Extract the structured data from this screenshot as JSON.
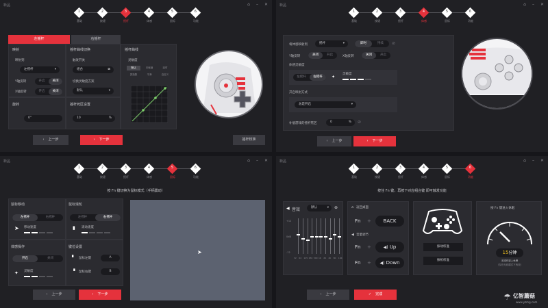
{
  "window": {
    "title": "新品",
    "ctrl_icons": [
      "pin-icon",
      "minimize-icon",
      "close-icon"
    ]
  },
  "steps": [
    {
      "num": "1",
      "label": "基础"
    },
    {
      "num": "2",
      "label": "按键"
    },
    {
      "num": "3",
      "label": "摇杆"
    },
    {
      "num": "4",
      "label": "体感"
    },
    {
      "num": "5",
      "label": "鼠标"
    },
    {
      "num": "6",
      "label": "功能"
    }
  ],
  "q1": {
    "tabs": {
      "left": "左摇杆",
      "right": "右摇杆"
    },
    "mapping": {
      "title": "映射",
      "mapto_label": "映射到",
      "mapto_value": "左摇杆",
      "y_invert": "Y轴反转",
      "x_invert": "X轴反转",
      "on": "开启",
      "off": "关闭"
    },
    "curve_switch": {
      "title": "摇杆曲线切换",
      "trigger_label": "触发开关",
      "trigger_value": "组合",
      "scheme_label": "切换灵敏度方案",
      "scheme_value": "默认"
    },
    "curve": {
      "title": "摇杆曲线",
      "sens_label": "灵敏度",
      "modes": [
        "默认",
        "已就绪",
        "延时",
        "类指数",
        "平滑",
        "自定义"
      ]
    },
    "rotate": {
      "title": "旋转",
      "value": "0°"
    },
    "deadzone": {
      "title": "摇杆死区设置",
      "value": "10",
      "unit": "%"
    },
    "prev": "上一步",
    "next": "下一步",
    "extra": "摇杆校准"
  },
  "q2": {
    "mapping_label": "将体感映射到",
    "mapping_value": "摇杆",
    "mode_a": "即时",
    "mode_b": "持续",
    "y_invert": "Y轴反转",
    "x_invert": "X轴反转",
    "on": "关闭",
    "off": "开启",
    "sens_title": "体感灵敏度",
    "stick_a": "左摇杆",
    "stick_b": "右摇杆",
    "sens_label": "灵敏度",
    "trigger_title": "开启映射方式",
    "trigger_value": "总是开启",
    "deadzone_label": "补偿游戏的摇杆死区",
    "deadzone_value": "0",
    "unit": "%",
    "prev": "上一步",
    "next": "下一步"
  },
  "q3": {
    "hint": "按 Fn 键切换为鼠标模式（手柄震动）",
    "move_title": "鼠标移动",
    "scroll_title": "鼠标滚轮",
    "move_left": "左摇杆",
    "move_right": "右摇杆",
    "move_speed": "移动速度",
    "scroll_left": "左摇杆",
    "scroll_right": "右摇杆",
    "scroll_speed": "滚动速度",
    "gyro_title": "体感操作",
    "gyro_on": "开启",
    "gyro_off": "关闭",
    "gyro_sens": "灵敏度",
    "keys_title": "键位设置",
    "left_click": "鼠标左键",
    "right_click": "鼠标右键",
    "key_a": "A",
    "key_b": "B",
    "prev": "上一步",
    "next": "下一步"
  },
  "q4": {
    "hint": "按住 Fn 键，再按下对应组合键 即可触发功能",
    "eq_title": "音效",
    "eq_preset": "默认",
    "eq_db": [
      "+12",
      "0dB",
      "-12"
    ],
    "eq_freqs": [
      "32",
      "64",
      "125",
      "250",
      "500",
      "1K",
      "2K",
      "4K",
      "8K",
      "16K"
    ],
    "eq_levels": [
      0.55,
      0.45,
      0.4,
      0.5,
      0.5,
      0.5,
      0.5,
      0.45,
      0.55,
      0.5
    ],
    "back_title": "返回桌面",
    "fn": "Fn",
    "plus": "+",
    "back_key": "BACK",
    "vol_title": "音量调节",
    "up": "Up",
    "down": "Down",
    "vib_test": "振动校准",
    "stick_cal": "振机校准",
    "sleep_title": "按 Fn 键进入休眠",
    "sleep_value": "15",
    "sleep_unit": "分钟",
    "sleep_note1": "无操作进入休眠",
    "sleep_note2": "（仅在无线模式下有效）",
    "prev": "上一步",
    "finish": "完成"
  },
  "watermark": {
    "brand": "亿智蘑菇",
    "site": "www.yzmg.com"
  },
  "colors": {
    "accent": "#e5323c",
    "panel": "#2b2b30",
    "bg": "#202024"
  }
}
